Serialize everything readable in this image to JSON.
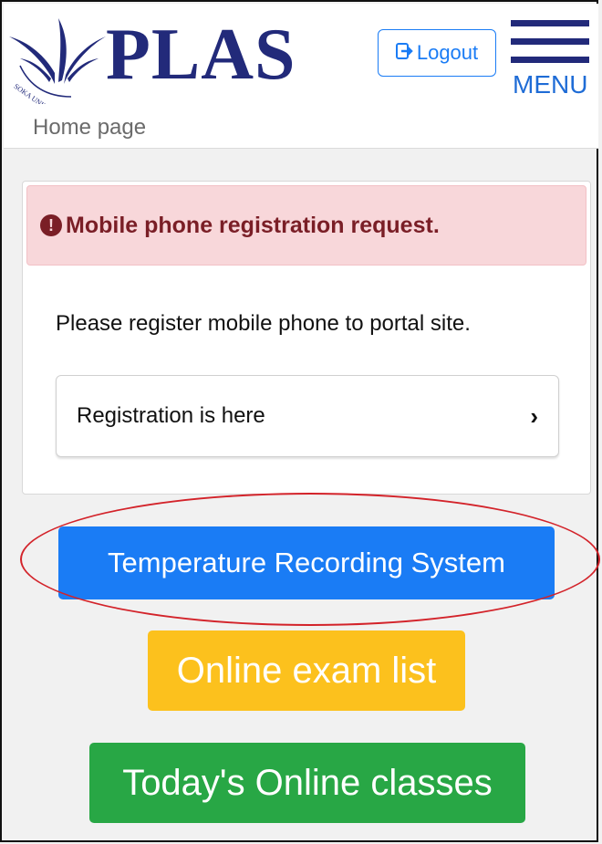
{
  "header": {
    "logo_text": "PLAS",
    "logo_seal_text": "SOKA UNIVERSITY",
    "logout_label": "Logout",
    "menu_label": "MENU"
  },
  "breadcrumb": "Home page",
  "notice": {
    "alert_text": "Mobile phone registration request.",
    "body_text": "Please register mobile phone to portal site.",
    "link_label": "Registration is here"
  },
  "buttons": {
    "temperature": "Temperature Recording System",
    "exam": "Online exam list",
    "today": "Today's Online classes"
  },
  "colors": {
    "brand_navy": "#222a7a",
    "primary_blue": "#1a7cf5",
    "alert_bg": "#f8d7da",
    "alert_text": "#7a1e26",
    "warning_yellow": "#fcc11d",
    "success_green": "#28a745",
    "highlight_red": "#d3232a"
  },
  "icons": {
    "logo": "plas-leaf-logo",
    "logout": "logout-arrow-icon",
    "menu": "hamburger-icon",
    "alert": "exclamation-circle-icon",
    "link": "chevron-right-icon"
  }
}
